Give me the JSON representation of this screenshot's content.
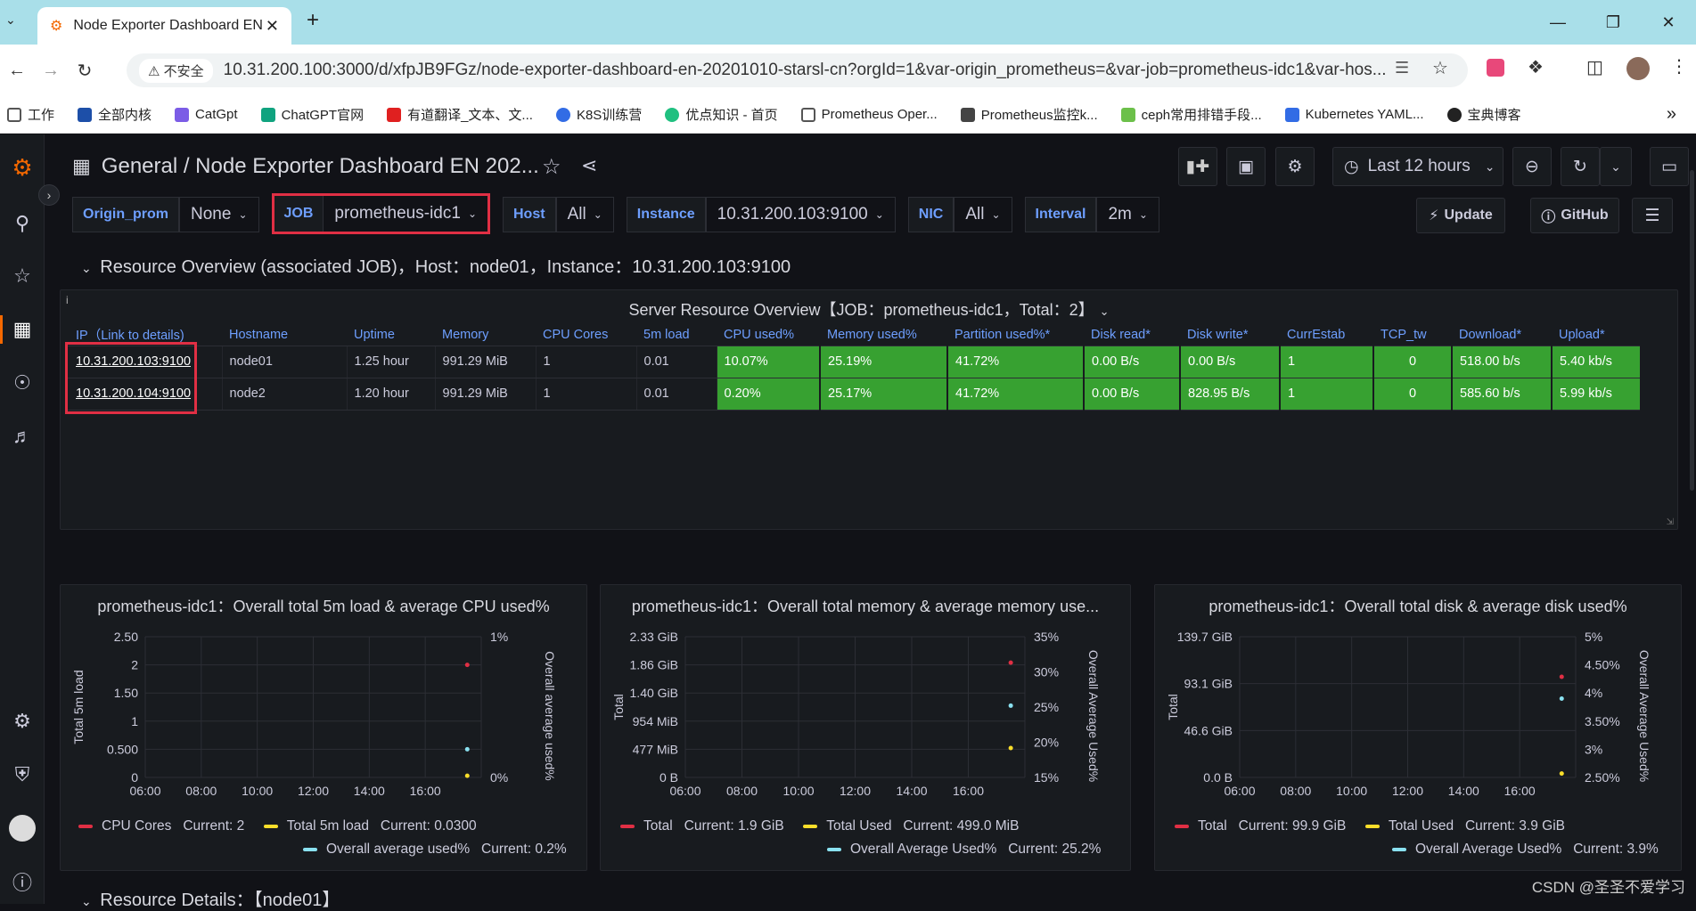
{
  "browser": {
    "tab_title": "Node Exporter Dashboard EN",
    "security_label": "不安全",
    "url": "10.31.200.100:3000/d/xfpJB9FGz/node-exporter-dashboard-en-20201010-starsl-cn?orgId=1&var-origin_prometheus=&var-job=prometheus-idc1&var-hos...",
    "bookmarks": [
      "工作",
      "全部内核",
      "CatGpt",
      "ChatGPT官网",
      "有道翻译_文本、文...",
      "K8S训练营",
      "优点知识 - 首页",
      "Prometheus Oper...",
      "Prometheus监控k...",
      "ceph常用排错手段...",
      "Kubernetes YAML...",
      "宝典博客"
    ]
  },
  "dashboard": {
    "breadcrumb": "General / Node Exporter Dashboard EN 202...",
    "time_range": "Last 12 hours",
    "update_label": "Update",
    "github_label": "GitHub"
  },
  "variables": [
    {
      "label": "Origin_prom",
      "value": "None"
    },
    {
      "label": "JOB",
      "value": "prometheus-idc1"
    },
    {
      "label": "Host",
      "value": "All"
    },
    {
      "label": "Instance",
      "value": "10.31.200.103:9100"
    },
    {
      "label": "NIC",
      "value": "All"
    },
    {
      "label": "Interval",
      "value": "2m"
    }
  ],
  "row_title": "Resource Overview (associated JOB)，Host：node01，Instance：10.31.200.103:9100",
  "overview": {
    "title": "Server Resource Overview【JOB：prometheus-idc1，Total：2】",
    "columns": [
      "IP（Link to details)",
      "Hostname",
      "Uptime",
      "Memory",
      "CPU Cores",
      "5m load",
      "CPU used%",
      "Memory used%",
      "Partition used%*",
      "Disk read*",
      "Disk write*",
      "CurrEstab",
      "TCP_tw",
      "Download*",
      "Upload*"
    ],
    "rows": [
      [
        "10.31.200.103:9100",
        "node01",
        "1.25 hour",
        "991.29 MiB",
        "1",
        "0.01",
        "10.07%",
        "25.19%",
        "41.72%",
        "0.00 B/s",
        "0.00 B/s",
        "1",
        "0",
        "518.00 b/s",
        "5.40 kb/s"
      ],
      [
        "10.31.200.104:9100",
        "node2",
        "1.20 hour",
        "991.29 MiB",
        "1",
        "0.01",
        "0.20%",
        "25.17%",
        "41.72%",
        "0.00 B/s",
        "828.95 B/s",
        "1",
        "0",
        "585.60 b/s",
        "5.99 kb/s"
      ]
    ]
  },
  "colors": {
    "red": "#e02f44",
    "yellow": "#fade2a",
    "cyan": "#8ae1f0",
    "green": "#37a131",
    "blue_label": "#6e9fff"
  },
  "chart_data": [
    {
      "type": "line",
      "title": "prometheus-idc1：Overall total 5m load & average CPU used%",
      "ylabel": "Total 5m load",
      "y2label": "Overall average used%",
      "x": [
        "06:00",
        "08:00",
        "10:00",
        "12:00",
        "14:00",
        "16:00"
      ],
      "y_ticks": [
        "2.50",
        "2",
        "1.50",
        "1",
        "0.500",
        "0"
      ],
      "y2_ticks": [
        "1%",
        "0%"
      ],
      "ylim": [
        0,
        2.5
      ],
      "y2lim": [
        0,
        1
      ],
      "series": [
        {
          "name": "CPU Cores",
          "color": "#e02f44",
          "axis": "left",
          "last": 2
        },
        {
          "name": "Total 5m load",
          "color": "#fade2a",
          "axis": "left",
          "last": 0.03
        },
        {
          "name": "Overall average used%",
          "color": "#8ae1f0",
          "axis": "right",
          "last": 0.2
        }
      ],
      "legend": [
        {
          "name": "CPU Cores",
          "current": "Current: 2",
          "color": "#e02f44"
        },
        {
          "name": "Total 5m load",
          "current": "Current: 0.0300",
          "color": "#fade2a"
        },
        {
          "name": "Overall average used%",
          "current": "Current: 0.2%",
          "color": "#8ae1f0"
        }
      ]
    },
    {
      "type": "line",
      "title": "prometheus-idc1：Overall total memory & average memory use...",
      "ylabel": "Total",
      "y2label": "Overall Average Used%",
      "x": [
        "06:00",
        "08:00",
        "10:00",
        "12:00",
        "14:00",
        "16:00"
      ],
      "y_ticks": [
        "2.33 GiB",
        "1.86 GiB",
        "1.40 GiB",
        "954 MiB",
        "477 MiB",
        "0 B"
      ],
      "y2_ticks": [
        "35%",
        "30%",
        "25%",
        "20%",
        "15%"
      ],
      "ylim": [
        0,
        2.33
      ],
      "y2lim": [
        15,
        35
      ],
      "series": [
        {
          "name": "Total",
          "color": "#e02f44",
          "axis": "left",
          "last": 1.9
        },
        {
          "name": "Total Used",
          "color": "#fade2a",
          "axis": "left",
          "last": 0.487
        },
        {
          "name": "Overall Average Used%",
          "color": "#8ae1f0",
          "axis": "right",
          "last": 25.2
        }
      ],
      "legend": [
        {
          "name": "Total",
          "current": "Current: 1.9 GiB",
          "color": "#e02f44"
        },
        {
          "name": "Total Used",
          "current": "Current: 499.0 MiB",
          "color": "#fade2a"
        },
        {
          "name": "Overall Average Used%",
          "current": "Current: 25.2%",
          "color": "#8ae1f0"
        }
      ]
    },
    {
      "type": "line",
      "title": "prometheus-idc1：Overall total disk & average disk used%",
      "ylabel": "Total",
      "y2label": "Overall Average Used%",
      "x": [
        "06:00",
        "08:00",
        "10:00",
        "12:00",
        "14:00",
        "16:00"
      ],
      "y_ticks": [
        "139.7 GiB",
        "93.1 GiB",
        "46.6 GiB",
        "0.0 B"
      ],
      "y2_ticks": [
        "5%",
        "4.50%",
        "4%",
        "3.50%",
        "3%",
        "2.50%"
      ],
      "ylim": [
        0,
        139.7
      ],
      "y2lim": [
        2.5,
        5
      ],
      "series": [
        {
          "name": "Total",
          "color": "#e02f44",
          "axis": "left",
          "last": 99.9
        },
        {
          "name": "Total Used",
          "color": "#fade2a",
          "axis": "left",
          "last": 3.9
        },
        {
          "name": "Overall Average Used%",
          "color": "#8ae1f0",
          "axis": "right",
          "last": 3.9
        }
      ],
      "legend": [
        {
          "name": "Total",
          "current": "Current: 99.9 GiB",
          "color": "#e02f44"
        },
        {
          "name": "Total Used",
          "current": "Current: 3.9 GiB",
          "color": "#fade2a"
        },
        {
          "name": "Overall Average Used%",
          "current": "Current: 3.9%",
          "color": "#8ae1f0"
        }
      ]
    }
  ],
  "next_row_title": "Resource Details：【node01】",
  "watermark": "CSDN @圣圣不爱学习"
}
